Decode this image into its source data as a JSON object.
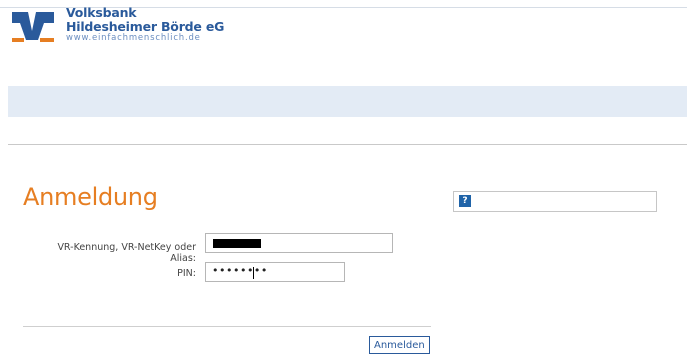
{
  "brand": {
    "line1": "Volksbank",
    "line2": "Hildesheimer Börde eG",
    "url": "www.einfachmenschlich.de",
    "logo": "vr-bank-logo",
    "colors": {
      "blue": "#2a5a9b",
      "orange": "#e67e22"
    }
  },
  "login": {
    "title": "Anmeldung",
    "user_label": "VR-Kennung, VR-NetKey oder Alias:",
    "pin_label": "PIN:",
    "pin_masked": "••••••••",
    "submit_label": "Anmelden"
  },
  "help": {
    "icon": "?"
  }
}
